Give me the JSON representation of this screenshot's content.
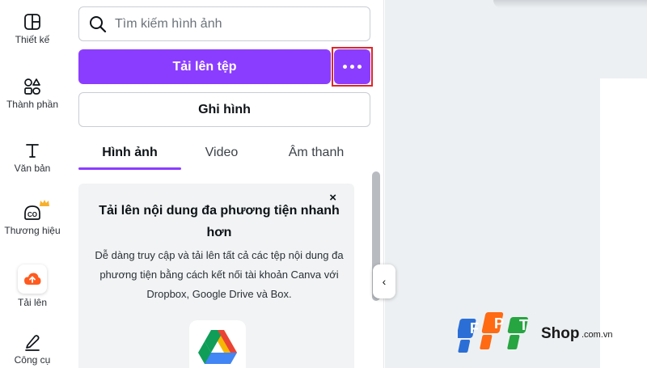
{
  "rail": {
    "items": [
      {
        "label": "Thiết kế",
        "icon": "layout-icon"
      },
      {
        "label": "Thành phần",
        "icon": "shapes-icon"
      },
      {
        "label": "Văn bản",
        "icon": "text-icon"
      },
      {
        "label": "Thương hiệu",
        "icon": "brand-icon"
      },
      {
        "label": "Tải lên",
        "icon": "cloud-upload-icon"
      },
      {
        "label": "Công cụ",
        "icon": "draw-icon"
      }
    ]
  },
  "search": {
    "placeholder": "Tìm kiếm hình ảnh",
    "value": ""
  },
  "buttons": {
    "upload": "Tải lên tệp",
    "record": "Ghi hình"
  },
  "tabs": [
    {
      "label": "Hình ảnh",
      "active": true
    },
    {
      "label": "Video",
      "active": false
    },
    {
      "label": "Âm thanh",
      "active": false
    }
  ],
  "card": {
    "title": "Tải lên nội dung đa phương tiện nhanh hơn",
    "description": "Dễ dàng truy cập và tải lên tất cả các tệp nội dung đa phương tiện bằng cách kết nối tài khoản Canva với Dropbox, Google Drive và Box.",
    "close": "×"
  },
  "collapse": {
    "icon": "‹"
  },
  "watermark": {
    "brand": "FPT",
    "shop": "Shop",
    "domain": ".com.vn"
  },
  "colors": {
    "accent": "#8b3dff",
    "highlight": "#e0262b",
    "upload_icon": "#ff5a1f"
  }
}
